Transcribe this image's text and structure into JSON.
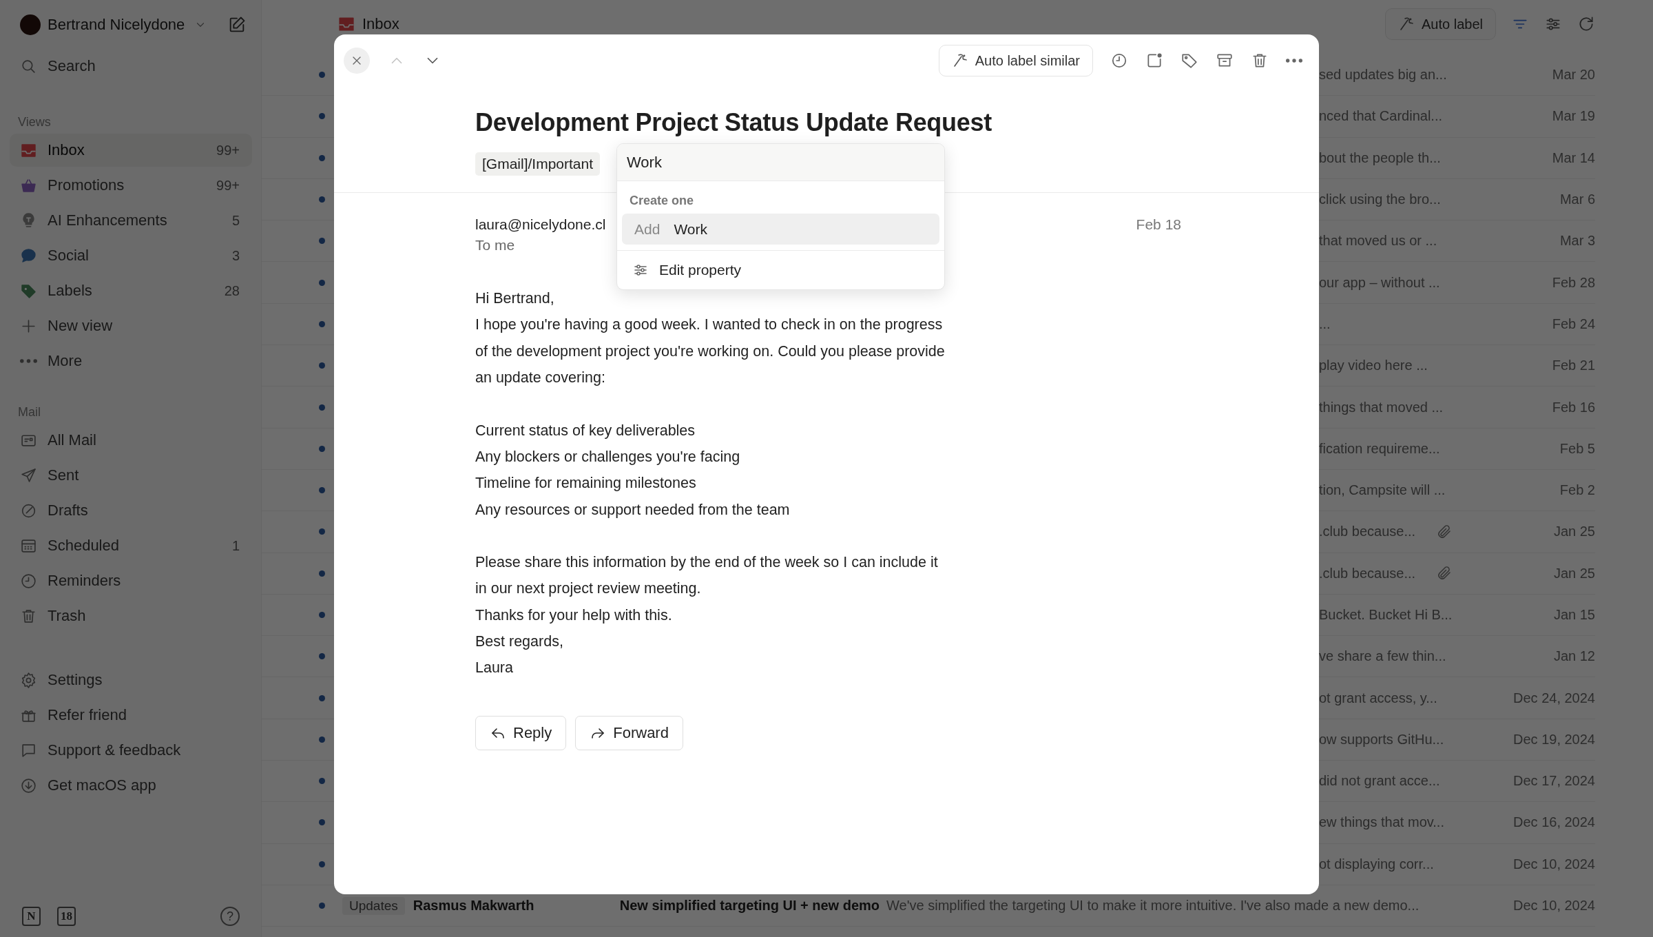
{
  "sidebar": {
    "account": {
      "name": "Bertrand Nicelydone"
    },
    "search": {
      "label": "Search"
    },
    "sections": [
      {
        "title": "Views",
        "items": [
          {
            "kind": "inbox",
            "label": "Inbox",
            "count": "99+",
            "selected": true
          },
          {
            "kind": "promotions",
            "label": "Promotions",
            "count": "99+",
            "selected": false
          },
          {
            "kind": "bulb",
            "label": "AI Enhancements",
            "count": "5",
            "selected": false
          },
          {
            "kind": "social",
            "label": "Social",
            "count": "3",
            "selected": false
          },
          {
            "kind": "labels",
            "label": "Labels",
            "count": "28",
            "selected": false
          },
          {
            "kind": "plus",
            "label": "New view",
            "selected": false
          },
          {
            "kind": "more",
            "label": "More",
            "selected": false
          }
        ]
      },
      {
        "title": "Mail",
        "items": [
          {
            "kind": "allmail",
            "label": "All Mail",
            "selected": false
          },
          {
            "kind": "sent",
            "label": "Sent",
            "selected": false
          },
          {
            "kind": "drafts",
            "label": "Drafts",
            "selected": false
          },
          {
            "kind": "scheduled",
            "label": "Scheduled",
            "count": "1",
            "selected": false
          },
          {
            "kind": "reminders",
            "label": "Reminders",
            "selected": false
          },
          {
            "kind": "trash",
            "label": "Trash",
            "selected": false
          }
        ]
      }
    ],
    "footer_items": [
      {
        "kind": "settings",
        "label": "Settings"
      },
      {
        "kind": "gift",
        "label": "Refer friend"
      },
      {
        "kind": "support",
        "label": "Support & feedback"
      },
      {
        "kind": "download",
        "label": "Get macOS app"
      }
    ],
    "apps": [
      "N",
      "18"
    ],
    "help": "?"
  },
  "header": {
    "title": "Inbox",
    "auto_label_button": "Auto label"
  },
  "messages": [
    {
      "kind": "partial",
      "unread": true,
      "snippet": "sed updates big an...",
      "attachment": false,
      "date": "Mar 20"
    },
    {
      "kind": "partial",
      "unread": true,
      "snippet": "nced that Cardinal...",
      "attachment": false,
      "date": "Mar 19"
    },
    {
      "kind": "partial",
      "unread": true,
      "snippet": "bout the people th...",
      "attachment": false,
      "date": "Mar 14"
    },
    {
      "kind": "partial",
      "unread": true,
      "snippet": "click using the bro...",
      "attachment": false,
      "date": "Mar 6"
    },
    {
      "kind": "partial",
      "unread": true,
      "snippet": "that moved us or ...",
      "attachment": false,
      "date": "Mar 3"
    },
    {
      "kind": "partial",
      "unread": true,
      "snippet": "our app – without ...",
      "attachment": false,
      "date": "Feb 28"
    },
    {
      "kind": "partial",
      "unread": true,
      "snippet": "...",
      "attachment": false,
      "date": "Feb 24"
    },
    {
      "kind": "partial",
      "unread": true,
      "snippet": "play video here  ...",
      "attachment": false,
      "date": "Feb 21"
    },
    {
      "kind": "partial",
      "unread": true,
      "snippet": "things that moved ...",
      "attachment": false,
      "date": "Feb 16"
    },
    {
      "kind": "partial",
      "unread": true,
      "snippet": "fication requireme...",
      "attachment": false,
      "date": "Feb 5"
    },
    {
      "kind": "partial",
      "unread": true,
      "snippet": "tion, Campsite will ...",
      "attachment": false,
      "date": "Feb 2"
    },
    {
      "kind": "partial",
      "unread": true,
      "snippet": ".club because...",
      "attachment": true,
      "date": "Jan 25"
    },
    {
      "kind": "partial",
      "unread": true,
      "snippet": ".club because...",
      "attachment": true,
      "date": "Jan 25"
    },
    {
      "kind": "partial",
      "unread": true,
      "snippet": "Bucket. Bucket Hi B...",
      "attachment": false,
      "date": "Jan 15"
    },
    {
      "kind": "partial",
      "unread": true,
      "snippet": "ve share a few thin...",
      "attachment": false,
      "date": "Jan 12"
    },
    {
      "kind": "partial",
      "unread": true,
      "snippet": "ot grant access, y...",
      "attachment": false,
      "date": "Dec 24, 2024"
    },
    {
      "kind": "partial",
      "unread": true,
      "snippet": "ow supports GitHu...",
      "attachment": false,
      "date": "Dec 19, 2024"
    },
    {
      "kind": "partial",
      "unread": true,
      "snippet": "did not grant acce...",
      "attachment": false,
      "date": "Dec 17, 2024"
    },
    {
      "kind": "partial",
      "unread": true,
      "snippet": "ew things that mov...",
      "attachment": false,
      "date": "Dec 16, 2024"
    },
    {
      "kind": "partial",
      "unread": true,
      "snippet": "ot displaying corr...",
      "attachment": false,
      "date": "Dec 10, 2024"
    },
    {
      "kind": "full",
      "unread": true,
      "tag": "Updates",
      "sender": "Rasmus Makwarth",
      "subject": "New simplified targeting UI + new demo",
      "snippet": "We've simplified the targeting UI to make it more intuitive. I've also made a new demo...",
      "attachment": false,
      "date": "Dec 10, 2024"
    }
  ],
  "email_modal": {
    "nav": [
      {
        "kind": "up",
        "disabled": true
      },
      {
        "kind": "down",
        "disabled": false
      }
    ],
    "auto_label_button": "Auto label similar",
    "subject": "Development Project Status Update Request",
    "labels": [
      "[Gmail]/Important"
    ],
    "from": "laura@nicelydone.cl",
    "to": "To me",
    "date": "Feb 18",
    "body": [
      [
        "Hi Bertrand,",
        "I hope you're having a good week. I wanted to check in on the progress",
        "of the development project you're working on. Could you please provide",
        "an update covering:"
      ],
      [
        "Current status of key deliverables",
        "Any blockers or challenges you're facing",
        "Timeline for remaining milestones",
        "Any resources or support needed from the team"
      ],
      [
        "Please share this information by the end of the week so I can include it",
        "in our next project review meeting.",
        "Thanks for your help with this.",
        "Best regards,",
        "Laura"
      ]
    ],
    "buttons": [
      {
        "kind": "reply",
        "label": "Reply"
      },
      {
        "kind": "forward",
        "label": "Forward"
      }
    ],
    "label_dropdown": {
      "query": "Work",
      "section": "Create one",
      "options": [
        {
          "prefix": "Add",
          "value": "Work",
          "selected": true
        }
      ],
      "action": "Edit property"
    }
  }
}
